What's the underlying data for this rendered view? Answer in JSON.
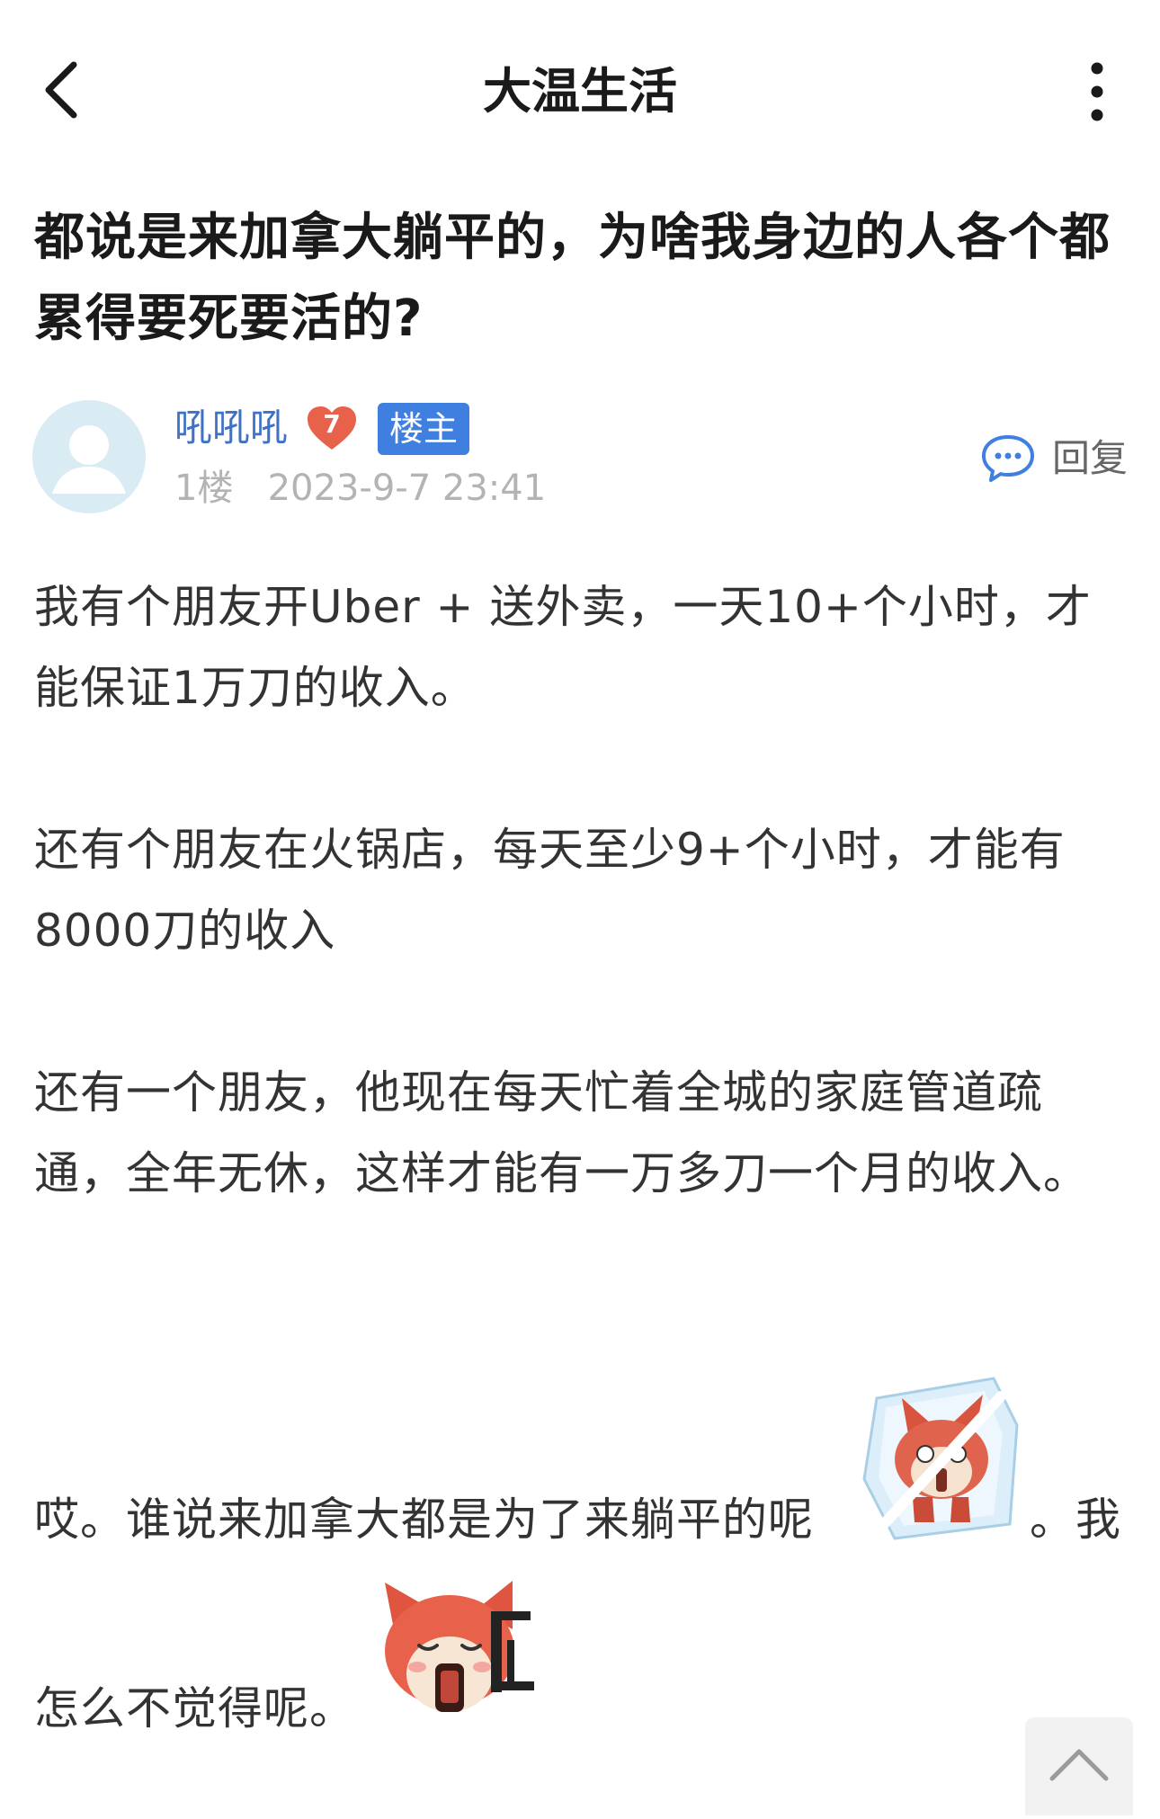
{
  "navbar": {
    "title": "大温生活"
  },
  "post": {
    "title": "都说是来加拿大躺平的，为啥我身边的人各个都累得要死要活的?"
  },
  "author": {
    "name": "吼吼吼",
    "level": "7",
    "op_badge": "楼主",
    "floor": "1楼",
    "timestamp": "2023-9-7 23:41",
    "reply_label": "回复"
  },
  "body": {
    "paragraphs": [
      "我有个朋友开Uber + 送外卖，一天10+个小时，才能保证1万刀的收入。",
      "还有个朋友在火锅店，每天至少9+个小时，才能有8000刀的收入",
      "还有一个朋友，他现在每天忙着全城的家庭管道疏通，全年无休，这样才能有一万多刀一个月的收入。"
    ],
    "line4_a": "哎。谁说来加拿大都是为了来躺平的呢",
    "line4_b": "。我",
    "line5": "怎么不觉得呢。"
  },
  "icons": {
    "back": "chevron-left-icon",
    "more": "more-vertical-icon",
    "avatar": "default-avatar-icon",
    "level": "heart-level-icon",
    "reply": "speech-bubble-icon",
    "emoji1": "frozen-fox-emoji",
    "emoji2": "crying-fox-emoji",
    "scroll_top": "chevron-up-icon"
  },
  "colors": {
    "author_name": "#3d72c7",
    "op_badge_bg": "#3f7fe0",
    "level_badge": "#e8614a",
    "meta_gray": "#b3b3b3",
    "avatar_bg": "#d9ecf3"
  }
}
